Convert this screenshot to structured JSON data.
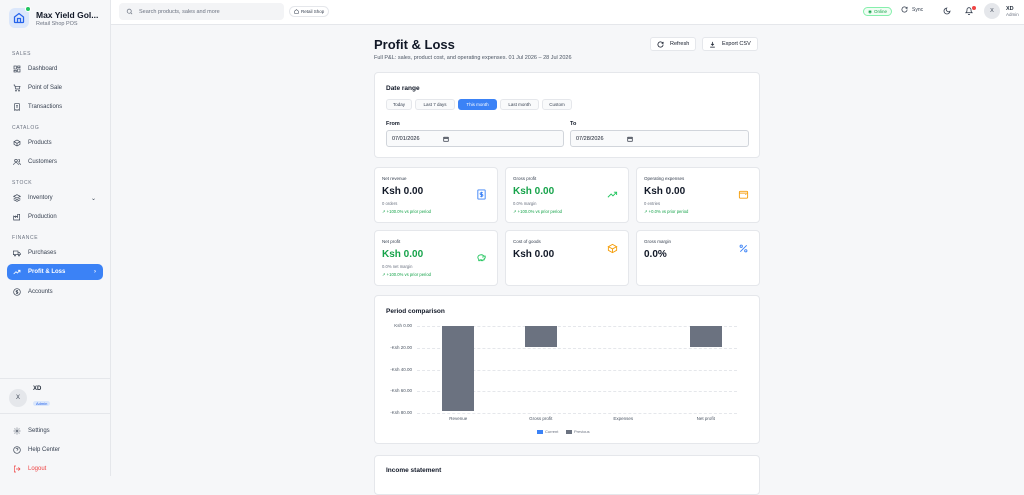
{
  "app": {
    "name": "Max Yield Gol...",
    "subtitle": "Retail Shop POS"
  },
  "sidebar": {
    "sections": {
      "sales": "SALES",
      "catalog": "CATALOG",
      "stock": "STOCK",
      "finance": "FINANCE"
    },
    "items": {
      "dashboard": "Dashboard",
      "pos": "Point of Sale",
      "transactions": "Transactions",
      "products": "Products",
      "customers": "Customers",
      "inventory": "Inventory",
      "production": "Production",
      "purchases": "Purchases",
      "profit_loss": "Profit & Loss",
      "accounts": "Accounts"
    },
    "user": {
      "initial": "X",
      "name": "XD",
      "role": "Admin"
    },
    "bottom": {
      "settings": "Settings",
      "help": "Help Center",
      "logout": "Logout"
    }
  },
  "topbar": {
    "search_placeholder": "Search products, sales and more",
    "shop": "Retail Shop",
    "status": "Online",
    "sync": "Sync",
    "user_initial": "X",
    "user_name": "XD",
    "user_role": "Admin"
  },
  "page": {
    "title": "Profit & Loss",
    "subtitle": "Full P&L: sales, product cost, and operating expenses. 01 Jul 2026 – 28 Jul 2026",
    "refresh": "Refresh",
    "export": "Export CSV"
  },
  "date_range": {
    "title": "Date range",
    "presets": [
      "Today",
      "Last 7 days",
      "This month",
      "Last month",
      "Custom"
    ],
    "active_preset": "This month",
    "from_label": "From",
    "to_label": "To",
    "from_value": "07/01/2026",
    "to_value": "07/28/2026"
  },
  "metrics": {
    "net_revenue": {
      "label": "Net revenue",
      "value": "Ksh 0.00",
      "sub": "0 orders",
      "trend": "↗ +100.0% vs prior period"
    },
    "gross_profit": {
      "label": "Gross profit",
      "value": "Ksh 0.00",
      "sub": "0.0% margin",
      "trend": "↗ +100.0% vs prior period"
    },
    "operating_expenses": {
      "label": "Operating expenses",
      "value": "Ksh 0.00",
      "sub": "0 entries",
      "trend": "↗ +0.0% vs prior period"
    },
    "net_profit": {
      "label": "Net profit",
      "value": "Ksh 0.00",
      "sub": "0.0% net margin",
      "trend": "↗ +100.0% vs prior period"
    },
    "cost_of_goods": {
      "label": "Cost of goods",
      "value": "Ksh 0.00"
    },
    "gross_margin": {
      "label": "Gross margin",
      "value": "0.0%"
    }
  },
  "comparison": {
    "title": "Period comparison"
  },
  "chart_data": {
    "type": "bar",
    "title": "Period comparison",
    "categories": [
      "Revenue",
      "Gross profit",
      "Expenses",
      "Net profit"
    ],
    "series": [
      {
        "name": "Current",
        "values": [
          0,
          0,
          0,
          0
        ],
        "color": "#3b82f6"
      },
      {
        "name": "Previous",
        "values": [
          -78,
          -19,
          0,
          -19
        ],
        "color": "#6b7280"
      }
    ],
    "y_ticks": [
      "Ksh 0.00",
      "-Ksh 20.00",
      "-Ksh 40.00",
      "-Ksh 60.00",
      "-Ksh 80.00"
    ],
    "ylim": [
      -80,
      0
    ],
    "grid": true,
    "legend_position": "bottom"
  },
  "income_statement": {
    "title": "Income statement"
  }
}
